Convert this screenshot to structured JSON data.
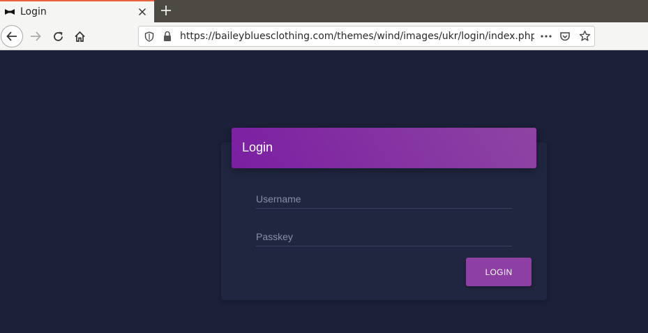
{
  "browser": {
    "tab": {
      "title": "Login",
      "favicon": "bowtie-icon"
    },
    "url": "https://baileybluesclothing.com/themes/wind/images/ukr/login/index.php?v"
  },
  "login": {
    "title": "Login",
    "username_placeholder": "Username",
    "passkey_placeholder": "Passkey",
    "button_label": "LOGIN"
  },
  "colors": {
    "background": "#1c2038",
    "card": "#20263f",
    "header_gradient_start": "#7b1fa2",
    "header_gradient_end": "#8e44a3",
    "button": "#8e3fa3"
  }
}
